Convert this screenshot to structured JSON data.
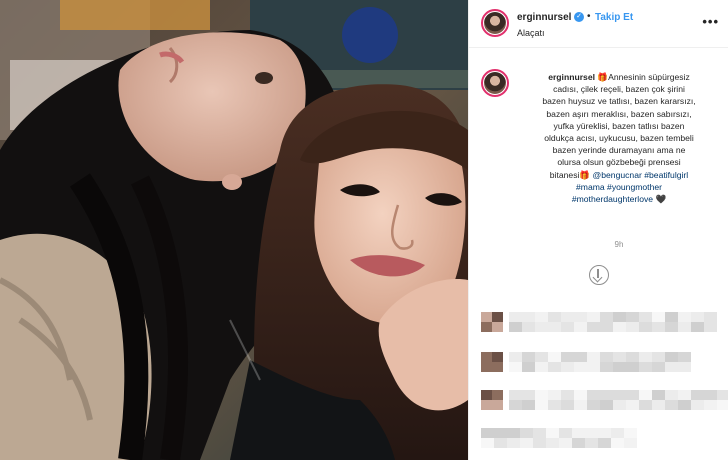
{
  "header": {
    "username": "erginnursel",
    "verified_icon": "verified-badge-icon",
    "follow_label": "Takip Et",
    "separator": "•",
    "location": "Alaçatı",
    "more_label": "•••"
  },
  "caption": {
    "username": "erginnursel",
    "lines": [
      "🎁Annesinin süpürgesiz",
      "cadısı, çilek reçeli, bazen çok şirini",
      "bazen huysuz ve tatlısı, bazen kararsızı,",
      "bazen aşırı meraklısı, bazen sabırsızı,",
      "yufka yüreklisi, bazen tatlısı bazen",
      "oldukça acısı, uykucusu, bazen tembeli",
      "bazen yerinde duramayanı ama ne",
      "olursa olsun gözbebeği prensesi"
    ],
    "line_last_text": "bitanesi🎁 ",
    "mention": "@bengucnar",
    "tag_beatifulgirl": "#beatifulgirl",
    "tag_mama": "#mama",
    "tag_youngmother": "#youngmother",
    "tag_motherdaughter": "#motherdaughterlove",
    "heart": "🖤",
    "time_ago": "9h"
  },
  "colors": {
    "accent": "#3897f0",
    "hashtag": "#00376b",
    "story_ring": "#e1306c",
    "muted": "#8e8e8e"
  }
}
